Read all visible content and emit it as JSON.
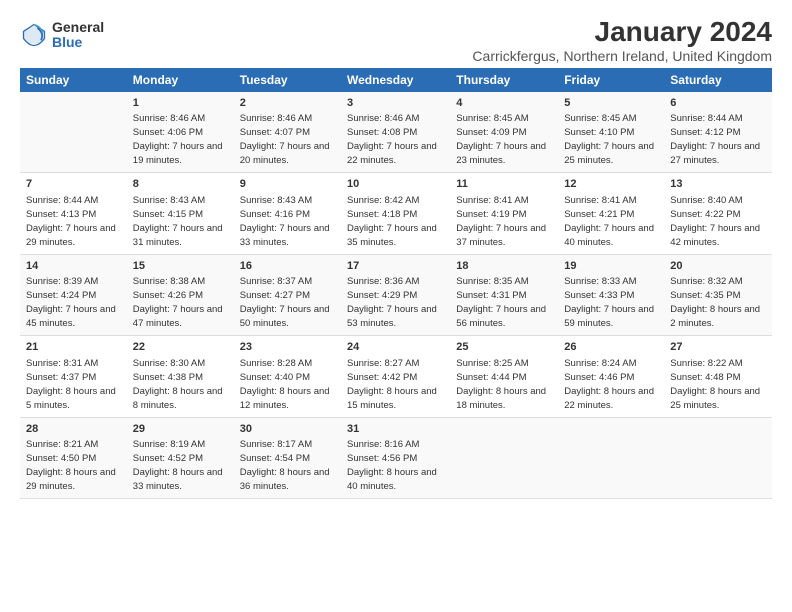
{
  "logo": {
    "general": "General",
    "blue": "Blue"
  },
  "title": "January 2024",
  "subtitle": "Carrickfergus, Northern Ireland, United Kingdom",
  "header_days": [
    "Sunday",
    "Monday",
    "Tuesday",
    "Wednesday",
    "Thursday",
    "Friday",
    "Saturday"
  ],
  "weeks": [
    [
      {
        "num": "",
        "sunrise": "",
        "sunset": "",
        "daylight": ""
      },
      {
        "num": "1",
        "sunrise": "Sunrise: 8:46 AM",
        "sunset": "Sunset: 4:06 PM",
        "daylight": "Daylight: 7 hours and 19 minutes."
      },
      {
        "num": "2",
        "sunrise": "Sunrise: 8:46 AM",
        "sunset": "Sunset: 4:07 PM",
        "daylight": "Daylight: 7 hours and 20 minutes."
      },
      {
        "num": "3",
        "sunrise": "Sunrise: 8:46 AM",
        "sunset": "Sunset: 4:08 PM",
        "daylight": "Daylight: 7 hours and 22 minutes."
      },
      {
        "num": "4",
        "sunrise": "Sunrise: 8:45 AM",
        "sunset": "Sunset: 4:09 PM",
        "daylight": "Daylight: 7 hours and 23 minutes."
      },
      {
        "num": "5",
        "sunrise": "Sunrise: 8:45 AM",
        "sunset": "Sunset: 4:10 PM",
        "daylight": "Daylight: 7 hours and 25 minutes."
      },
      {
        "num": "6",
        "sunrise": "Sunrise: 8:44 AM",
        "sunset": "Sunset: 4:12 PM",
        "daylight": "Daylight: 7 hours and 27 minutes."
      }
    ],
    [
      {
        "num": "7",
        "sunrise": "Sunrise: 8:44 AM",
        "sunset": "Sunset: 4:13 PM",
        "daylight": "Daylight: 7 hours and 29 minutes."
      },
      {
        "num": "8",
        "sunrise": "Sunrise: 8:43 AM",
        "sunset": "Sunset: 4:15 PM",
        "daylight": "Daylight: 7 hours and 31 minutes."
      },
      {
        "num": "9",
        "sunrise": "Sunrise: 8:43 AM",
        "sunset": "Sunset: 4:16 PM",
        "daylight": "Daylight: 7 hours and 33 minutes."
      },
      {
        "num": "10",
        "sunrise": "Sunrise: 8:42 AM",
        "sunset": "Sunset: 4:18 PM",
        "daylight": "Daylight: 7 hours and 35 minutes."
      },
      {
        "num": "11",
        "sunrise": "Sunrise: 8:41 AM",
        "sunset": "Sunset: 4:19 PM",
        "daylight": "Daylight: 7 hours and 37 minutes."
      },
      {
        "num": "12",
        "sunrise": "Sunrise: 8:41 AM",
        "sunset": "Sunset: 4:21 PM",
        "daylight": "Daylight: 7 hours and 40 minutes."
      },
      {
        "num": "13",
        "sunrise": "Sunrise: 8:40 AM",
        "sunset": "Sunset: 4:22 PM",
        "daylight": "Daylight: 7 hours and 42 minutes."
      }
    ],
    [
      {
        "num": "14",
        "sunrise": "Sunrise: 8:39 AM",
        "sunset": "Sunset: 4:24 PM",
        "daylight": "Daylight: 7 hours and 45 minutes."
      },
      {
        "num": "15",
        "sunrise": "Sunrise: 8:38 AM",
        "sunset": "Sunset: 4:26 PM",
        "daylight": "Daylight: 7 hours and 47 minutes."
      },
      {
        "num": "16",
        "sunrise": "Sunrise: 8:37 AM",
        "sunset": "Sunset: 4:27 PM",
        "daylight": "Daylight: 7 hours and 50 minutes."
      },
      {
        "num": "17",
        "sunrise": "Sunrise: 8:36 AM",
        "sunset": "Sunset: 4:29 PM",
        "daylight": "Daylight: 7 hours and 53 minutes."
      },
      {
        "num": "18",
        "sunrise": "Sunrise: 8:35 AM",
        "sunset": "Sunset: 4:31 PM",
        "daylight": "Daylight: 7 hours and 56 minutes."
      },
      {
        "num": "19",
        "sunrise": "Sunrise: 8:33 AM",
        "sunset": "Sunset: 4:33 PM",
        "daylight": "Daylight: 7 hours and 59 minutes."
      },
      {
        "num": "20",
        "sunrise": "Sunrise: 8:32 AM",
        "sunset": "Sunset: 4:35 PM",
        "daylight": "Daylight: 8 hours and 2 minutes."
      }
    ],
    [
      {
        "num": "21",
        "sunrise": "Sunrise: 8:31 AM",
        "sunset": "Sunset: 4:37 PM",
        "daylight": "Daylight: 8 hours and 5 minutes."
      },
      {
        "num": "22",
        "sunrise": "Sunrise: 8:30 AM",
        "sunset": "Sunset: 4:38 PM",
        "daylight": "Daylight: 8 hours and 8 minutes."
      },
      {
        "num": "23",
        "sunrise": "Sunrise: 8:28 AM",
        "sunset": "Sunset: 4:40 PM",
        "daylight": "Daylight: 8 hours and 12 minutes."
      },
      {
        "num": "24",
        "sunrise": "Sunrise: 8:27 AM",
        "sunset": "Sunset: 4:42 PM",
        "daylight": "Daylight: 8 hours and 15 minutes."
      },
      {
        "num": "25",
        "sunrise": "Sunrise: 8:25 AM",
        "sunset": "Sunset: 4:44 PM",
        "daylight": "Daylight: 8 hours and 18 minutes."
      },
      {
        "num": "26",
        "sunrise": "Sunrise: 8:24 AM",
        "sunset": "Sunset: 4:46 PM",
        "daylight": "Daylight: 8 hours and 22 minutes."
      },
      {
        "num": "27",
        "sunrise": "Sunrise: 8:22 AM",
        "sunset": "Sunset: 4:48 PM",
        "daylight": "Daylight: 8 hours and 25 minutes."
      }
    ],
    [
      {
        "num": "28",
        "sunrise": "Sunrise: 8:21 AM",
        "sunset": "Sunset: 4:50 PM",
        "daylight": "Daylight: 8 hours and 29 minutes."
      },
      {
        "num": "29",
        "sunrise": "Sunrise: 8:19 AM",
        "sunset": "Sunset: 4:52 PM",
        "daylight": "Daylight: 8 hours and 33 minutes."
      },
      {
        "num": "30",
        "sunrise": "Sunrise: 8:17 AM",
        "sunset": "Sunset: 4:54 PM",
        "daylight": "Daylight: 8 hours and 36 minutes."
      },
      {
        "num": "31",
        "sunrise": "Sunrise: 8:16 AM",
        "sunset": "Sunset: 4:56 PM",
        "daylight": "Daylight: 8 hours and 40 minutes."
      },
      {
        "num": "",
        "sunrise": "",
        "sunset": "",
        "daylight": ""
      },
      {
        "num": "",
        "sunrise": "",
        "sunset": "",
        "daylight": ""
      },
      {
        "num": "",
        "sunrise": "",
        "sunset": "",
        "daylight": ""
      }
    ]
  ]
}
